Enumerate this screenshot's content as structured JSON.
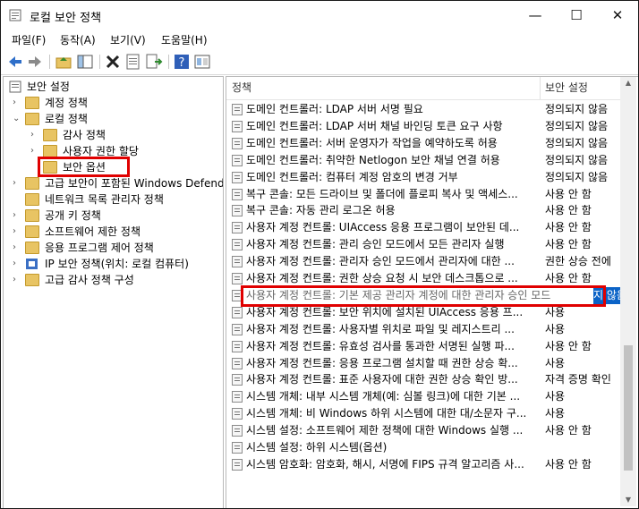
{
  "window": {
    "title": "로컬 보안 정책",
    "min_glyph": "—",
    "max_glyph": "☐",
    "close_glyph": "✕"
  },
  "menu": [
    "파일(F)",
    "동작(A)",
    "보기(V)",
    "도움말(H)"
  ],
  "tree": {
    "root": "보안 설정",
    "items": [
      {
        "label": "계정 정책",
        "expand": "›"
      },
      {
        "label": "로컬 정책",
        "expand": "⌄"
      },
      {
        "label": "감사 정책",
        "expand": "›"
      },
      {
        "label": "사용자 권한 할당",
        "expand": "›"
      },
      {
        "label": "보안 옵션",
        "expand": ""
      },
      {
        "label": "고급 보안이 포함된 Windows Defende",
        "expand": "›"
      },
      {
        "label": "네트워크 목록 관리자 정책",
        "expand": ""
      },
      {
        "label": "공개 키 정책",
        "expand": "›"
      },
      {
        "label": "소프트웨어 제한 정책",
        "expand": "›"
      },
      {
        "label": "응용 프로그램 제어 정책",
        "expand": "›"
      },
      {
        "label": "IP 보안 정책(위치: 로컬 컴퓨터)",
        "expand": "›"
      },
      {
        "label": "고급 감사 정책 구성",
        "expand": "›"
      }
    ]
  },
  "columns": {
    "policy": "정책",
    "setting": "보안 설정"
  },
  "rows": [
    {
      "policy": "도메인 컨트롤러: LDAP 서버 서명 필요",
      "setting": "정의되지 않음"
    },
    {
      "policy": "도메인 컨트롤러: LDAP 서버 채널 바인딩 토큰 요구 사항",
      "setting": "정의되지 않음"
    },
    {
      "policy": "도메인 컨트롤러: 서버 운영자가 작업을 예약하도록 허용",
      "setting": "정의되지 않음"
    },
    {
      "policy": "도메인 컨트롤러: 취약한 Netlogon 보안 채널 연결 허용",
      "setting": "정의되지 않음"
    },
    {
      "policy": "도메인 컨트롤러: 컴퓨터 계정 암호의 변경 거부",
      "setting": "정의되지 않음"
    },
    {
      "policy": "복구 콘솔: 모든 드라이브 및 폴더에 플로피 복사 및 액세스...",
      "setting": "사용 안 함"
    },
    {
      "policy": "복구 콘솔: 자동 관리 로그온 허용",
      "setting": "사용 안 함"
    },
    {
      "policy": "사용자 계정 컨트롤: UIAccess 응용 프로그램이 보안된 데...",
      "setting": "사용 안 함"
    },
    {
      "policy": "사용자 계정 컨트롤: 관리 승인 모드에서 모든 관리자 실행",
      "setting": "사용 안 함"
    },
    {
      "policy": "사용자 계정 컨트롤: 관리자 승인 모드에서 관리자에 대한 ...",
      "setting": "권한 상승 전에"
    },
    {
      "policy": "사용자 계정 컨트롤: 권한 상승 요청 시 보안 데스크톱으로 ...",
      "setting": "사용 안 함"
    },
    {
      "policy": "사용자 계정 컨트롤: 기본 제공 관리자 계정에 대한 관리자 승인 모드",
      "setting": "지 않음"
    },
    {
      "policy": "사용자 계정 컨트롤: 보안 위치에 설치된 UIAccess 응용 프...",
      "setting": "사용"
    },
    {
      "policy": "사용자 계정 컨트롤: 사용자별 위치로 파일 및 레지스트리 ...",
      "setting": "사용"
    },
    {
      "policy": "사용자 계정 컨트롤: 유효성 검사를 통과한 서명된 실행 파...",
      "setting": "사용 안 함"
    },
    {
      "policy": "사용자 계정 컨트롤: 응용 프로그램 설치할 때 권한 상승 확...",
      "setting": "사용"
    },
    {
      "policy": "사용자 계정 컨트롤: 표준 사용자에 대한 권한 상승 확인 방...",
      "setting": "자격 증명 확인"
    },
    {
      "policy": "시스템 개체: 내부 시스템 개체(예: 심볼 링크)에 대한 기본 ...",
      "setting": "사용"
    },
    {
      "policy": "시스템 개체: 비 Windows 하위 시스템에 대한 대/소문자 구...",
      "setting": "사용"
    },
    {
      "policy": "시스템 설정: 소프트웨어 제한 정책에 대한 Windows 실행 ...",
      "setting": "사용 안 함"
    },
    {
      "policy": "시스템 설정: 하위 시스템(옵션)",
      "setting": ""
    },
    {
      "policy": "시스템 암호화: 암호화, 해시, 서명에 FIPS 규격 알고리즘 사...",
      "setting": "사용 안 함"
    }
  ],
  "selected_row": 11,
  "colors": {
    "highlight": "#e00000",
    "folder": "#e8c463"
  }
}
